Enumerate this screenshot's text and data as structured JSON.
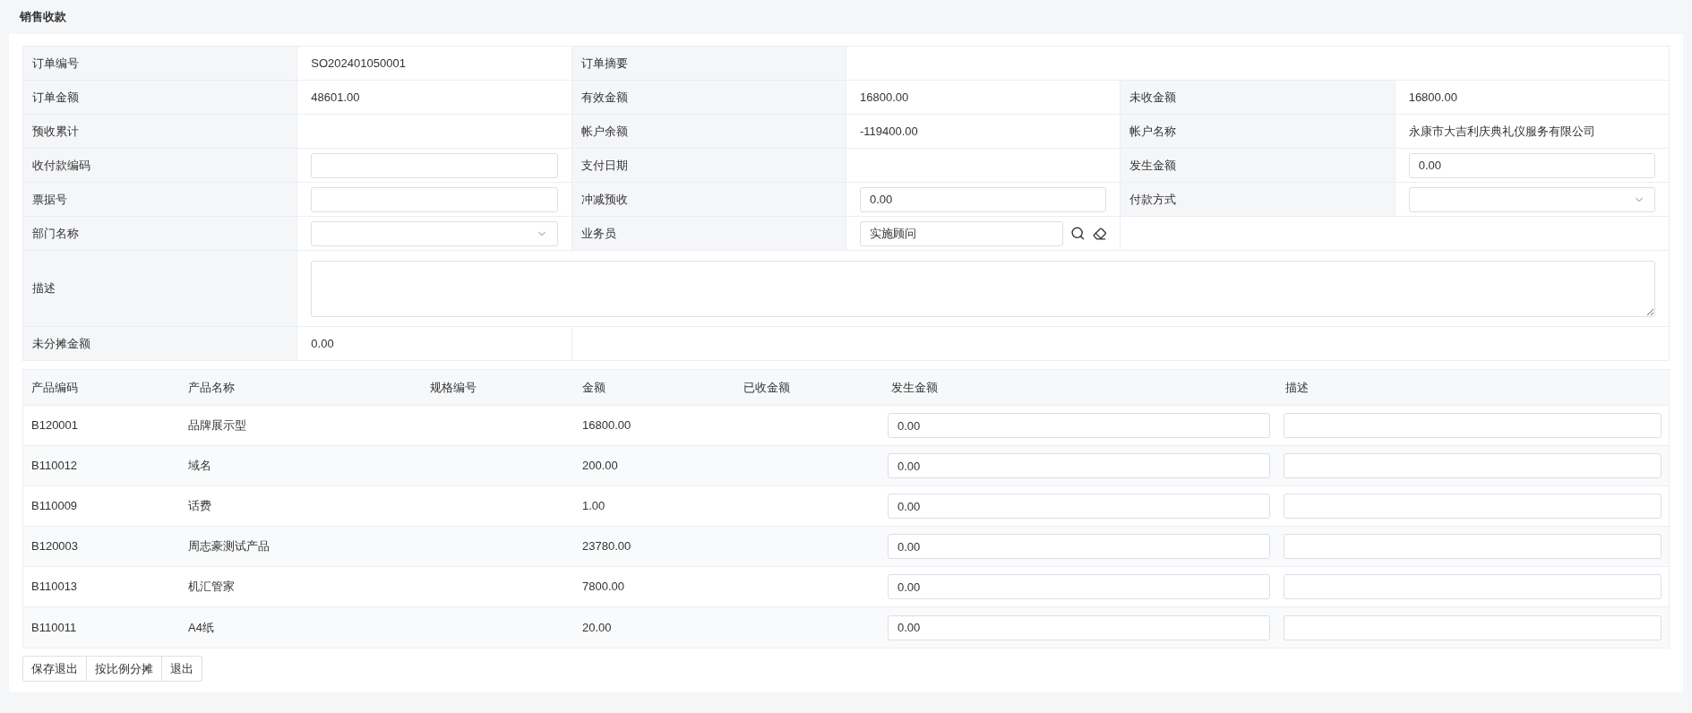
{
  "page_title": "销售收款",
  "form": {
    "rows": [
      [
        {
          "kind": "label",
          "text": "订单编号"
        },
        {
          "kind": "text",
          "text": "SO202401050001"
        },
        {
          "kind": "label",
          "text": "订单摘要"
        },
        {
          "kind": "blank"
        }
      ],
      [
        {
          "kind": "label",
          "text": "订单金额"
        },
        {
          "kind": "text",
          "text": "48601.00"
        },
        {
          "kind": "label",
          "text": "有效金额"
        },
        {
          "kind": "text",
          "text": "16800.00"
        },
        {
          "kind": "label",
          "text": "未收金额"
        },
        {
          "kind": "text",
          "text": "16800.00"
        }
      ],
      [
        {
          "kind": "label",
          "text": "预收累计"
        },
        {
          "kind": "blank"
        },
        {
          "kind": "label",
          "text": "帐户余额"
        },
        {
          "kind": "text",
          "text": "-119400.00"
        },
        {
          "kind": "label",
          "text": "帐户名称"
        },
        {
          "kind": "text",
          "text": "永康市大吉利庆典礼仪服务有限公司"
        }
      ],
      [
        {
          "kind": "label",
          "text": "收付款编码"
        },
        {
          "kind": "input"
        },
        {
          "kind": "label",
          "text": "支付日期"
        },
        {
          "kind": "blank"
        },
        {
          "kind": "label",
          "text": "发生金额"
        },
        {
          "kind": "input",
          "value": "0.00"
        }
      ],
      [
        {
          "kind": "label",
          "text": "票据号"
        },
        {
          "kind": "input"
        },
        {
          "kind": "label",
          "text": "冲减预收"
        },
        {
          "kind": "input",
          "value": "0.00"
        },
        {
          "kind": "label",
          "text": "付款方式"
        },
        {
          "kind": "select"
        }
      ],
      [
        {
          "kind": "label",
          "text": "部门名称"
        },
        {
          "kind": "select"
        },
        {
          "kind": "label",
          "text": "业务员"
        },
        {
          "kind": "lookup",
          "value": "实施顾问"
        },
        {
          "kind": "blank"
        }
      ],
      [
        {
          "kind": "label",
          "text": "描述"
        },
        {
          "kind": "textarea"
        }
      ],
      [
        {
          "kind": "label",
          "text": "未分摊金额"
        },
        {
          "kind": "text",
          "text": "0.00"
        },
        {
          "kind": "blank"
        }
      ]
    ]
  },
  "table": {
    "columns": [
      "产品编码",
      "产品名称",
      "规格编号",
      "金额",
      "已收金额",
      "发生金额",
      "描述"
    ],
    "rows": [
      {
        "code": "B120001",
        "name": "品牌展示型",
        "amount": "16800.00",
        "occurrence": "0.00"
      },
      {
        "code": "B110012",
        "name": "域名",
        "amount": "200.00",
        "occurrence": "0.00"
      },
      {
        "code": "B110009",
        "name": "话费",
        "amount": "1.00",
        "occurrence": "0.00"
      },
      {
        "code": "B120003",
        "name": "周志豪测试产品",
        "amount": "23780.00",
        "occurrence": "0.00"
      },
      {
        "code": "B110013",
        "name": "机汇管家",
        "amount": "7800.00",
        "occurrence": "0.00"
      },
      {
        "code": "B110011",
        "name": "A4纸",
        "amount": "20.00",
        "occurrence": "0.00"
      }
    ]
  },
  "buttons": [
    "保存退出",
    "按比例分摊",
    "退出"
  ]
}
